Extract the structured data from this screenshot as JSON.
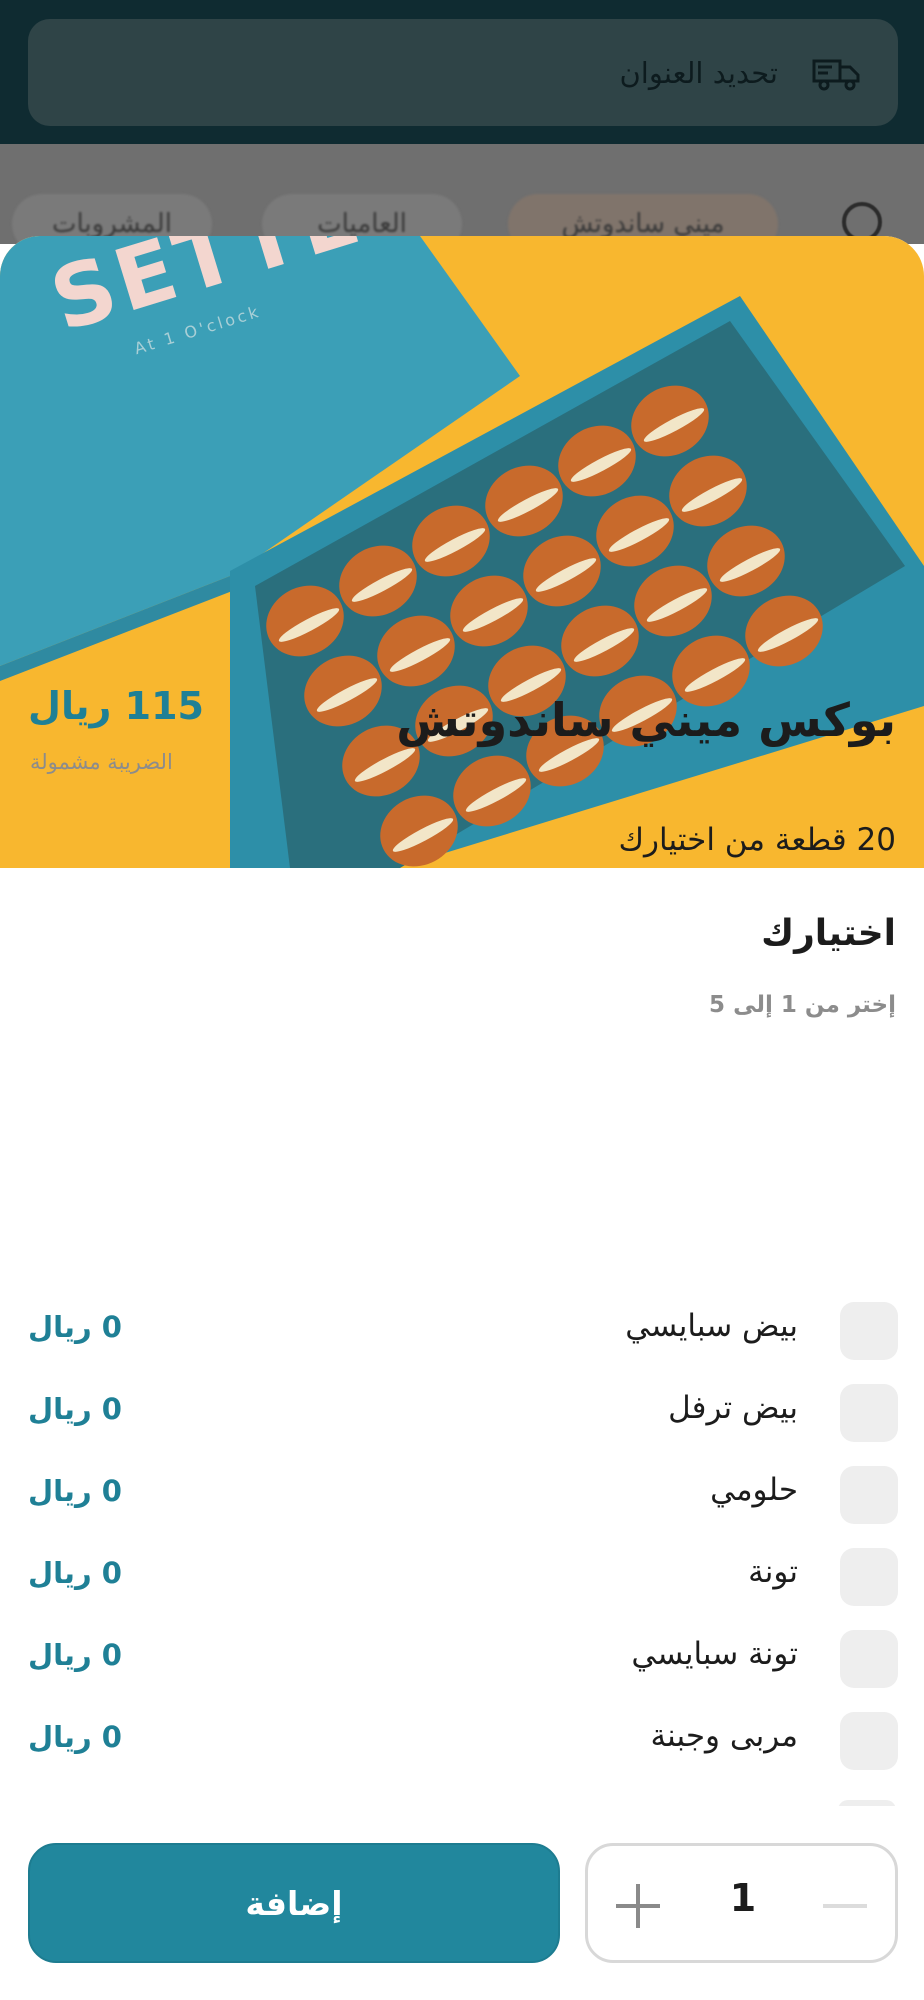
{
  "header": {
    "address_label": "تحديد العنوان",
    "truck_icon": "delivery-truck-icon"
  },
  "background_categories": [
    "المشروبات",
    "العاميات",
    "ميني ساندوتش"
  ],
  "hero": {
    "brand_name": "SETTE",
    "brand_tagline": "At 1 O'clock"
  },
  "product": {
    "title": "بوكس ميني ساندوتش",
    "price": "115 ريال",
    "tax_note": "الضريبة مشمولة",
    "description": "20 قطعة من اختيارك"
  },
  "options": {
    "heading": "اختيارك",
    "hint": "إختر من 1 إلى 5",
    "items": [
      {
        "label": "بيض سبايسي",
        "price": "0 ريال"
      },
      {
        "label": "بيض ترفل",
        "price": "0 ريال"
      },
      {
        "label": "حلومي",
        "price": "0 ريال"
      },
      {
        "label": "تونة",
        "price": "0 ريال"
      },
      {
        "label": "تونة سبايسي",
        "price": "0 ريال"
      },
      {
        "label": "مربى وجبنة",
        "price": "0 ريال"
      }
    ]
  },
  "cart": {
    "add_label": "إضافة",
    "quantity": "1"
  },
  "colors": {
    "accent": "#21879d",
    "price_text": "#1f8096",
    "hero_background": "#f8b72f",
    "box_color": "#3b9fb7"
  }
}
